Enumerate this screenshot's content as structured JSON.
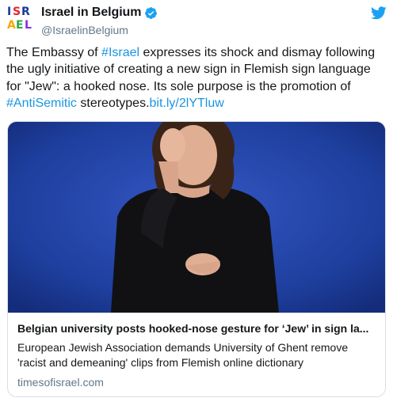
{
  "author": {
    "display_name": "Israel in Belgium",
    "handle": "@IsraelinBelgium",
    "avatar_icon": "israel-logo-icon",
    "verified_icon": "verified-badge-icon"
  },
  "brand": {
    "icon": "twitter-bird-icon",
    "color": "#1da1f2"
  },
  "tweet": {
    "text_1": "The Embassy of ",
    "hashtag_1": "#Israel",
    "text_2": " expresses its shock and dismay following the ugly initiative of creating a new sign in Flemish sign language for \"Jew\": a hooked nose. Its sole purpose is the promotion of ",
    "hashtag_2": "#AntiSemitic",
    "text_3": " stereotypes.",
    "link": "bit.ly/2lYTluw",
    "link_color": "#1b95e0"
  },
  "card": {
    "title": "Belgian university posts hooked-nose gesture for ‘Jew’ in sign la...",
    "description": "European Jewish Association demands University of Ghent remove 'racist and demeaning' clips from Flemish online dictionary",
    "domain": "timesofisrael.com"
  }
}
